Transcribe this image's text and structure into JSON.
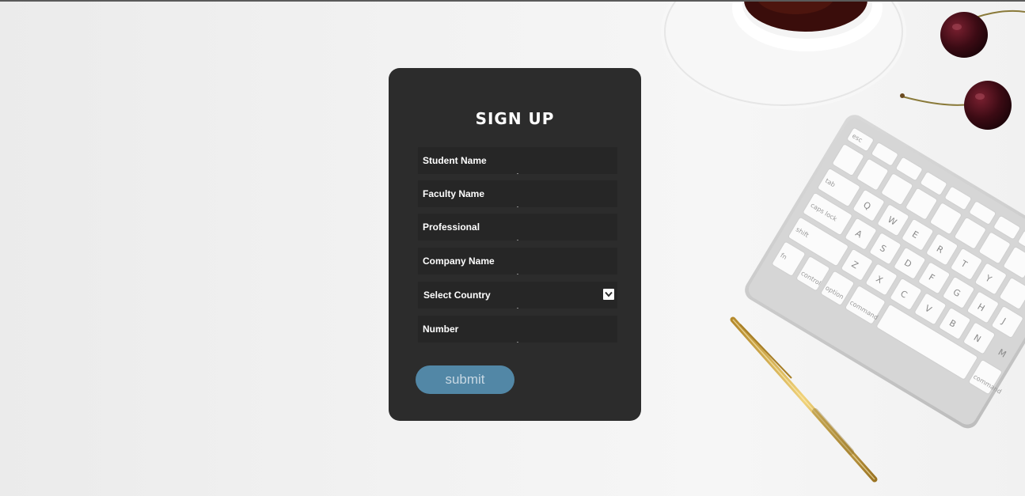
{
  "form": {
    "title": "SIGN UP",
    "fields": [
      {
        "placeholder": "Student Name"
      },
      {
        "placeholder": "Faculty Name"
      },
      {
        "placeholder": "Professional"
      },
      {
        "placeholder": "Company Name"
      }
    ],
    "country_select": {
      "selected": "Select Country"
    },
    "number_field": {
      "placeholder": "Number"
    },
    "submit_label": "submit"
  },
  "colors": {
    "card_bg": "#2c2c2c",
    "field_bg": "#262626",
    "button_bg": "#5287a6",
    "text": "#ffffff"
  },
  "keyboard": {
    "keys": [
      "esc",
      "tab",
      "caps lock",
      "shift",
      "fn",
      "control",
      "option",
      "command",
      "command",
      "Q",
      "W",
      "E",
      "R",
      "T",
      "Y",
      "A",
      "S",
      "D",
      "F",
      "G",
      "H",
      "J",
      "Z",
      "X",
      "C",
      "V",
      "B",
      "N",
      "M"
    ]
  }
}
